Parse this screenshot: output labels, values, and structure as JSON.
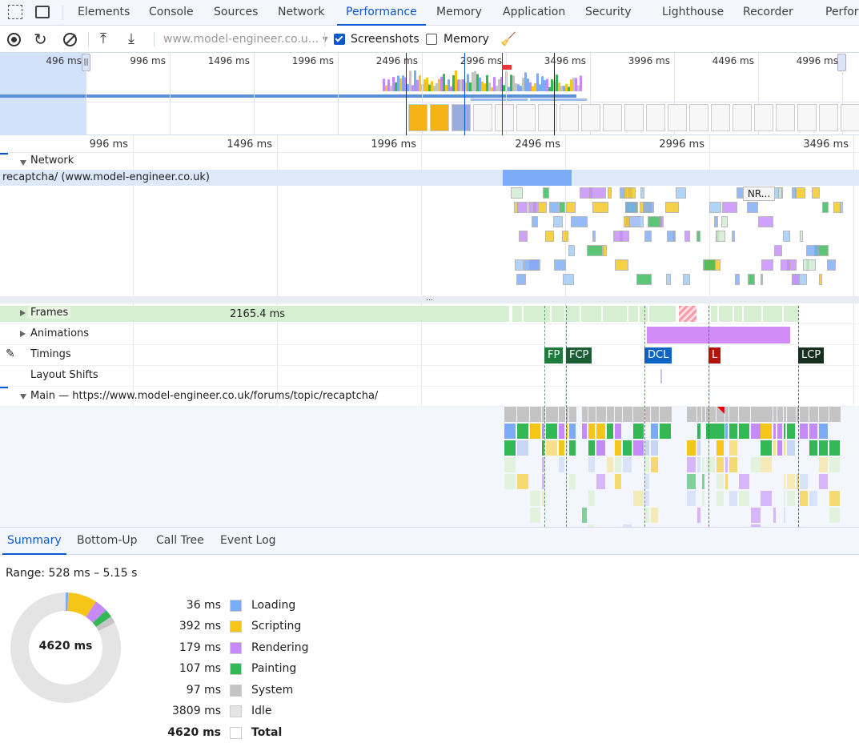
{
  "tabs": [
    {
      "label": "Elements"
    },
    {
      "label": "Console"
    },
    {
      "label": "Sources"
    },
    {
      "label": "Network"
    },
    {
      "label": "Performance",
      "active": true
    },
    {
      "label": "Memory"
    },
    {
      "label": "Application"
    },
    {
      "label": "Security"
    },
    {
      "label": "Lighthouse"
    },
    {
      "label": "Recorder"
    },
    {
      "label": "Perfor"
    }
  ],
  "toolbar": {
    "url_select": "www.model-engineer.co.u...",
    "screenshots_label": "Screenshots",
    "screenshots_checked": true,
    "memory_label": "Memory",
    "memory_checked": false
  },
  "overview": {
    "ticks": [
      "496 ms",
      "996 ms",
      "1496 ms",
      "1996 ms",
      "2496 ms",
      "2996 ms",
      "3496 ms",
      "3996 ms",
      "4496 ms",
      "4996 ms"
    ]
  },
  "timeline": {
    "ticks": [
      "996 ms",
      "1496 ms",
      "1996 ms",
      "2496 ms",
      "2996 ms",
      "3496 ms"
    ]
  },
  "network": {
    "label": "Network",
    "selected_request": "recaptcha/ (www.model-engineer.co.uk)",
    "truncated_request": "NR..."
  },
  "tracks": {
    "frames": "Frames",
    "frames_duration": "2165.4 ms",
    "animations": "Animations",
    "timings": "Timings",
    "layout_shifts": "Layout Shifts",
    "main": "Main — https://www.model-engineer.co.uk/forums/topic/recaptcha/"
  },
  "timings": [
    {
      "label": "FP",
      "color": "#1e7b3b"
    },
    {
      "label": "FCP",
      "color": "#1b5e33"
    },
    {
      "label": "DCL",
      "color": "#0b63c5"
    },
    {
      "label": "L",
      "color": "#b3140d"
    },
    {
      "label": "LCP",
      "color": "#16301f"
    }
  ],
  "bottom_tabs": [
    {
      "label": "Summary",
      "active": true
    },
    {
      "label": "Bottom-Up"
    },
    {
      "label": "Call Tree"
    },
    {
      "label": "Event Log"
    }
  ],
  "summary": {
    "range": "Range: 528 ms – 5.15 s",
    "total": "4620 ms",
    "categories": [
      {
        "value": "36 ms",
        "ms": 36,
        "name": "Loading",
        "color": "#7baaf7"
      },
      {
        "value": "392 ms",
        "ms": 392,
        "name": "Scripting",
        "color": "#f5c518"
      },
      {
        "value": "179 ms",
        "ms": 179,
        "name": "Rendering",
        "color": "#c58af9"
      },
      {
        "value": "107 ms",
        "ms": 107,
        "name": "Painting",
        "color": "#34b856"
      },
      {
        "value": "97 ms",
        "ms": 97,
        "name": "System",
        "color": "#c4c4c4"
      },
      {
        "value": "3809 ms",
        "ms": 3809,
        "name": "Idle",
        "color": "#e4e4e4"
      }
    ],
    "total_row": {
      "value": "4620 ms",
      "name": "Total"
    }
  }
}
